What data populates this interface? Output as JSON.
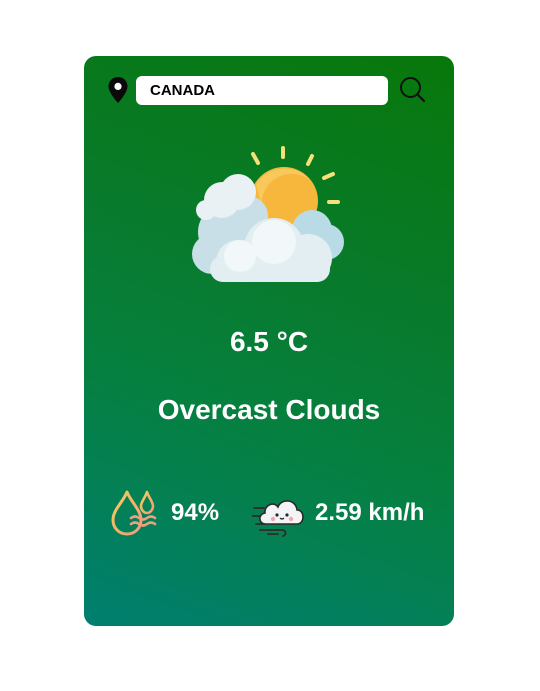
{
  "search": {
    "value": "CANADA",
    "placeholder": "",
    "location_icon": "map-pin-icon",
    "button_icon": "magnifier-icon"
  },
  "weather": {
    "icon": "sun-behind-clouds-icon",
    "temperature": "6.5 °C",
    "description": "Overcast Clouds"
  },
  "details": {
    "humidity": {
      "icon": "humidity-drops-icon",
      "value": "94%"
    },
    "wind": {
      "icon": "wind-cloud-icon",
      "value": "2.59 km/h"
    }
  },
  "colors": {
    "card_gradient_top": "#08780a",
    "card_gradient_bottom": "#007f70",
    "text": "#ffffff"
  }
}
